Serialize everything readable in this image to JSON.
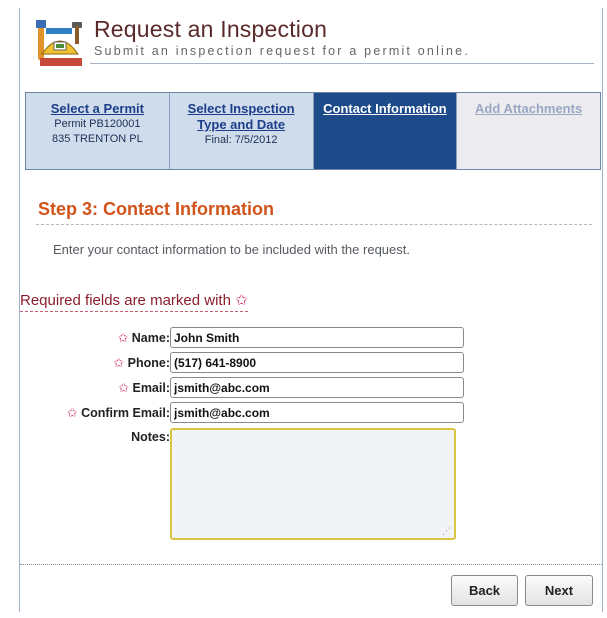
{
  "header": {
    "title": "Request an Inspection",
    "subtitle": "Submit an inspection request for a permit online."
  },
  "steps": [
    {
      "label": "Select a Permit",
      "detail_lines": [
        "Permit PB120001",
        "835 TRENTON PL"
      ],
      "state": "done"
    },
    {
      "label_lines": [
        "Select Inspection",
        "Type and Date"
      ],
      "detail_lines": [
        "Final: 7/5/2012"
      ],
      "state": "done"
    },
    {
      "label": "Contact Information",
      "state": "current"
    },
    {
      "label": "Add Attachments",
      "state": "future"
    }
  ],
  "step_heading": "Step 3: Contact Information",
  "instructions": "Enter your contact information to be included with the request.",
  "required_note": "Required fields are marked with",
  "required_star": "✩",
  "form": {
    "name_label": "Name:",
    "name_value": "John Smith",
    "phone_label": "Phone:",
    "phone_value": "(517) 641-8900",
    "email_label": "Email:",
    "email_value": "jsmith@abc.com",
    "confirm_email_label": "Confirm Email:",
    "confirm_email_value": "jsmith@abc.com",
    "notes_label": "Notes:",
    "notes_value": ""
  },
  "buttons": {
    "back": "Back",
    "next": "Next"
  },
  "colors": {
    "accent": "#d2541a",
    "current_step": "#1d4b8a",
    "required": "#8a1e2e"
  }
}
